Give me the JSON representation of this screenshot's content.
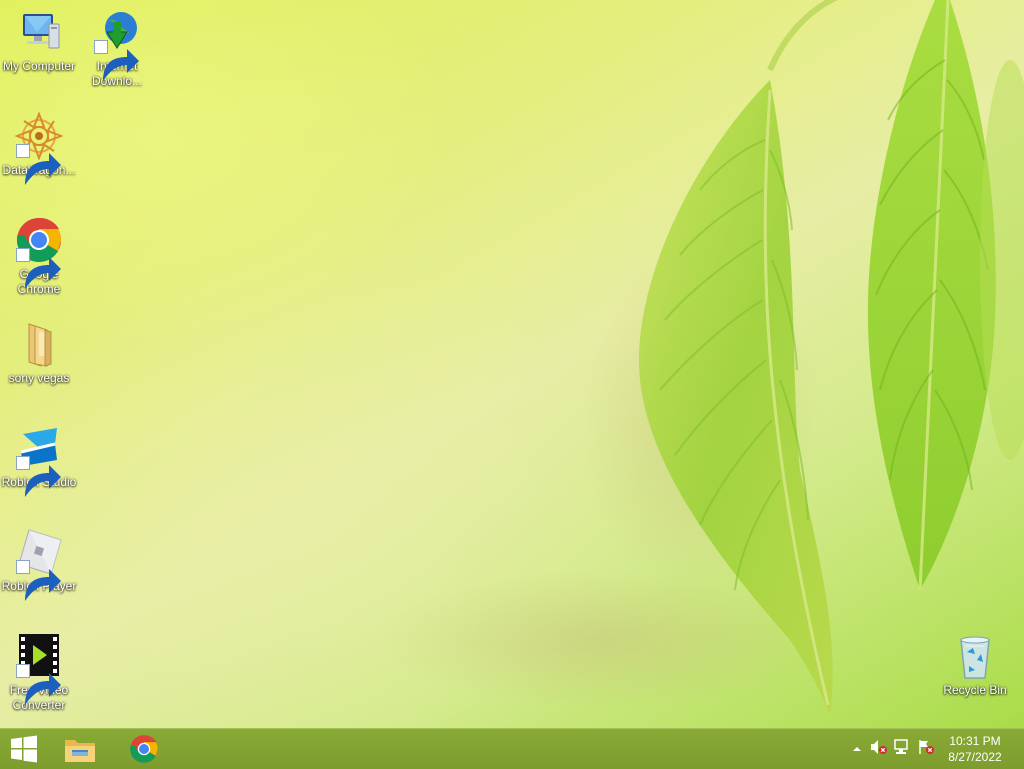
{
  "desktop_icons": {
    "my_computer": {
      "label": "My Computer"
    },
    "internet_download": {
      "label": "Internet Downlo..."
    },
    "datawagon": {
      "label": "DataWagon..."
    },
    "google_chrome": {
      "label": "Google Chrome"
    },
    "sony_vegas": {
      "label": "sony vegas"
    },
    "roblox_studio": {
      "label": "Roblox Studio"
    },
    "roblox_player": {
      "label": "Roblox Player"
    },
    "free_video_converter": {
      "label": "Free Video Converter"
    },
    "recycle_bin": {
      "label": "Recycle Bin"
    }
  },
  "taskbar": {
    "start_icon": "windows-logo-icon",
    "pinned": [
      "file-explorer-icon",
      "chrome-icon"
    ],
    "tray_icons": [
      "show-hidden-icons-chevron",
      "volume-muted-icon",
      "network-icon",
      "action-center-flag-icon"
    ],
    "clock": {
      "time": "10:31 PM",
      "date": "8/27/2022"
    }
  },
  "colors": {
    "taskbar": "#7f9f30",
    "wallpaper_accent": "#dff05a"
  }
}
